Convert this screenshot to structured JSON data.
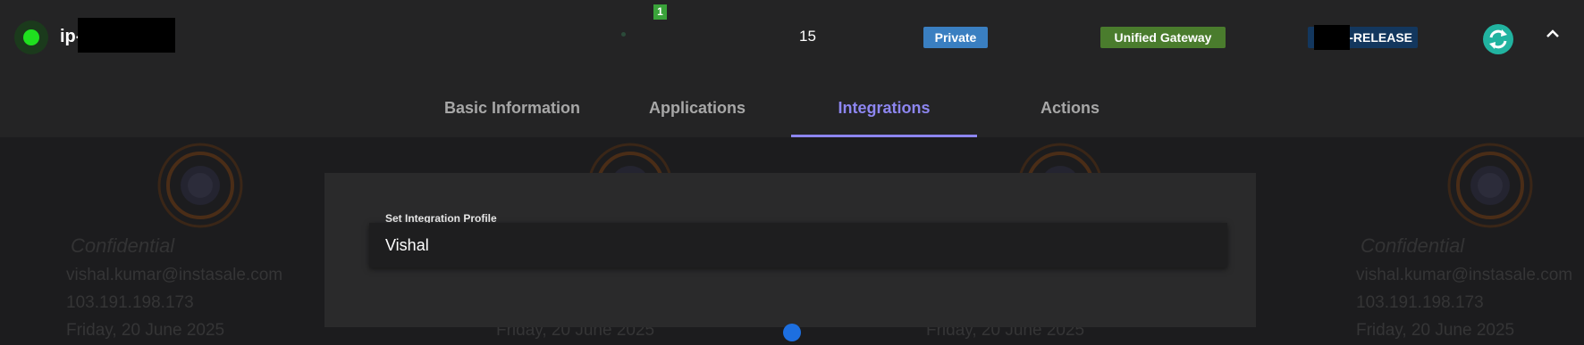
{
  "header": {
    "hostname_prefix": "ip-",
    "status": "online",
    "status_color": "#1fe01f",
    "count_badge": "1",
    "count_value": "15",
    "badges": {
      "private": "Private",
      "gateway": "Unified Gateway",
      "release": "-RELEASE"
    },
    "icons": [
      "status-dot-icon",
      "sync-icon",
      "chevron-up-icon"
    ]
  },
  "tabs": [
    {
      "label": "Basic Information",
      "active": false
    },
    {
      "label": "Applications",
      "active": false
    },
    {
      "label": "Integrations",
      "active": true
    },
    {
      "label": "Actions",
      "active": false
    }
  ],
  "integration": {
    "label": "Set Integration Profile",
    "value": "Vishal"
  },
  "watermark": {
    "confidential": "Confidential",
    "email": "vishal.kumar@instasale.com",
    "ip": "103.191.198.173",
    "date": "Friday, 20 June 2025"
  },
  "colors": {
    "accent": "#8d86f0",
    "private_badge": "#3a7fc1",
    "gateway_badge": "#4a7c2d",
    "release_badge": "#13375e",
    "sync": "#21b3a0"
  }
}
